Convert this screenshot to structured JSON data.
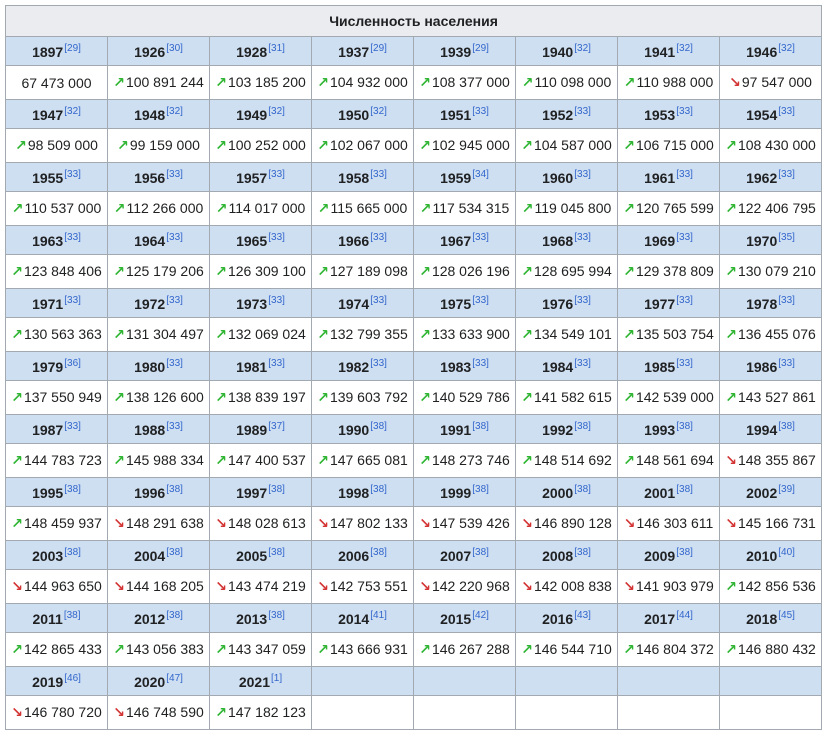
{
  "title": "Численность населения",
  "colors": {
    "up": "#2fb532",
    "down": "#d33333",
    "header_bg": "#cedff2",
    "title_bg": "#eaecf0"
  },
  "icons": {
    "up": "up-trend-arrow-icon",
    "down": "down-trend-arrow-icon"
  },
  "rows": [
    [
      {
        "year": "1897",
        "ref": "[29]",
        "value": "67 473 000",
        "trend": ""
      },
      {
        "year": "1926",
        "ref": "[30]",
        "value": "100 891 244",
        "trend": "up"
      },
      {
        "year": "1928",
        "ref": "[31]",
        "value": "103 185 200",
        "trend": "up"
      },
      {
        "year": "1937",
        "ref": "[29]",
        "value": "104 932 000",
        "trend": "up"
      },
      {
        "year": "1939",
        "ref": "[29]",
        "value": "108 377 000",
        "trend": "up"
      },
      {
        "year": "1940",
        "ref": "[32]",
        "value": "110 098 000",
        "trend": "up"
      },
      {
        "year": "1941",
        "ref": "[32]",
        "value": "110 988 000",
        "trend": "up"
      },
      {
        "year": "1946",
        "ref": "[32]",
        "value": "97 547 000",
        "trend": "down"
      }
    ],
    [
      {
        "year": "1947",
        "ref": "[32]",
        "value": "98 509 000",
        "trend": "up"
      },
      {
        "year": "1948",
        "ref": "[32]",
        "value": "99 159 000",
        "trend": "up"
      },
      {
        "year": "1949",
        "ref": "[32]",
        "value": "100 252 000",
        "trend": "up"
      },
      {
        "year": "1950",
        "ref": "[32]",
        "value": "102 067 000",
        "trend": "up"
      },
      {
        "year": "1951",
        "ref": "[33]",
        "value": "102 945 000",
        "trend": "up"
      },
      {
        "year": "1952",
        "ref": "[33]",
        "value": "104 587 000",
        "trend": "up"
      },
      {
        "year": "1953",
        "ref": "[33]",
        "value": "106 715 000",
        "trend": "up"
      },
      {
        "year": "1954",
        "ref": "[33]",
        "value": "108 430 000",
        "trend": "up"
      }
    ],
    [
      {
        "year": "1955",
        "ref": "[33]",
        "value": "110 537 000",
        "trend": "up"
      },
      {
        "year": "1956",
        "ref": "[33]",
        "value": "112 266 000",
        "trend": "up"
      },
      {
        "year": "1957",
        "ref": "[33]",
        "value": "114 017 000",
        "trend": "up"
      },
      {
        "year": "1958",
        "ref": "[33]",
        "value": "115 665 000",
        "trend": "up"
      },
      {
        "year": "1959",
        "ref": "[34]",
        "value": "117 534 315",
        "trend": "up"
      },
      {
        "year": "1960",
        "ref": "[33]",
        "value": "119 045 800",
        "trend": "up"
      },
      {
        "year": "1961",
        "ref": "[33]",
        "value": "120 765 599",
        "trend": "up"
      },
      {
        "year": "1962",
        "ref": "[33]",
        "value": "122 406 795",
        "trend": "up"
      }
    ],
    [
      {
        "year": "1963",
        "ref": "[33]",
        "value": "123 848 406",
        "trend": "up"
      },
      {
        "year": "1964",
        "ref": "[33]",
        "value": "125 179 206",
        "trend": "up"
      },
      {
        "year": "1965",
        "ref": "[33]",
        "value": "126 309 100",
        "trend": "up"
      },
      {
        "year": "1966",
        "ref": "[33]",
        "value": "127 189 098",
        "trend": "up"
      },
      {
        "year": "1967",
        "ref": "[33]",
        "value": "128 026 196",
        "trend": "up"
      },
      {
        "year": "1968",
        "ref": "[33]",
        "value": "128 695 994",
        "trend": "up"
      },
      {
        "year": "1969",
        "ref": "[33]",
        "value": "129 378 809",
        "trend": "up"
      },
      {
        "year": "1970",
        "ref": "[35]",
        "value": "130 079 210",
        "trend": "up"
      }
    ],
    [
      {
        "year": "1971",
        "ref": "[33]",
        "value": "130 563 363",
        "trend": "up"
      },
      {
        "year": "1972",
        "ref": "[33]",
        "value": "131 304 497",
        "trend": "up"
      },
      {
        "year": "1973",
        "ref": "[33]",
        "value": "132 069 024",
        "trend": "up"
      },
      {
        "year": "1974",
        "ref": "[33]",
        "value": "132 799 355",
        "trend": "up"
      },
      {
        "year": "1975",
        "ref": "[33]",
        "value": "133 633 900",
        "trend": "up"
      },
      {
        "year": "1976",
        "ref": "[33]",
        "value": "134 549 101",
        "trend": "up"
      },
      {
        "year": "1977",
        "ref": "[33]",
        "value": "135 503 754",
        "trend": "up"
      },
      {
        "year": "1978",
        "ref": "[33]",
        "value": "136 455 076",
        "trend": "up"
      }
    ],
    [
      {
        "year": "1979",
        "ref": "[36]",
        "value": "137 550 949",
        "trend": "up"
      },
      {
        "year": "1980",
        "ref": "[33]",
        "value": "138 126 600",
        "trend": "up"
      },
      {
        "year": "1981",
        "ref": "[33]",
        "value": "138 839 197",
        "trend": "up"
      },
      {
        "year": "1982",
        "ref": "[33]",
        "value": "139 603 792",
        "trend": "up"
      },
      {
        "year": "1983",
        "ref": "[33]",
        "value": "140 529 786",
        "trend": "up"
      },
      {
        "year": "1984",
        "ref": "[33]",
        "value": "141 582 615",
        "trend": "up"
      },
      {
        "year": "1985",
        "ref": "[33]",
        "value": "142 539 000",
        "trend": "up"
      },
      {
        "year": "1986",
        "ref": "[33]",
        "value": "143 527 861",
        "trend": "up"
      }
    ],
    [
      {
        "year": "1987",
        "ref": "[33]",
        "value": "144 783 723",
        "trend": "up"
      },
      {
        "year": "1988",
        "ref": "[33]",
        "value": "145 988 334",
        "trend": "up"
      },
      {
        "year": "1989",
        "ref": "[37]",
        "value": "147 400 537",
        "trend": "up"
      },
      {
        "year": "1990",
        "ref": "[38]",
        "value": "147 665 081",
        "trend": "up"
      },
      {
        "year": "1991",
        "ref": "[38]",
        "value": "148 273 746",
        "trend": "up"
      },
      {
        "year": "1992",
        "ref": "[38]",
        "value": "148 514 692",
        "trend": "up"
      },
      {
        "year": "1993",
        "ref": "[38]",
        "value": "148 561 694",
        "trend": "up"
      },
      {
        "year": "1994",
        "ref": "[38]",
        "value": "148 355 867",
        "trend": "down"
      }
    ],
    [
      {
        "year": "1995",
        "ref": "[38]",
        "value": "148 459 937",
        "trend": "up"
      },
      {
        "year": "1996",
        "ref": "[38]",
        "value": "148 291 638",
        "trend": "down"
      },
      {
        "year": "1997",
        "ref": "[38]",
        "value": "148 028 613",
        "trend": "down"
      },
      {
        "year": "1998",
        "ref": "[38]",
        "value": "147 802 133",
        "trend": "down"
      },
      {
        "year": "1999",
        "ref": "[38]",
        "value": "147 539 426",
        "trend": "down"
      },
      {
        "year": "2000",
        "ref": "[38]",
        "value": "146 890 128",
        "trend": "down"
      },
      {
        "year": "2001",
        "ref": "[38]",
        "value": "146 303 611",
        "trend": "down"
      },
      {
        "year": "2002",
        "ref": "[39]",
        "value": "145 166 731",
        "trend": "down"
      }
    ],
    [
      {
        "year": "2003",
        "ref": "[38]",
        "value": "144 963 650",
        "trend": "down"
      },
      {
        "year": "2004",
        "ref": "[38]",
        "value": "144 168 205",
        "trend": "down"
      },
      {
        "year": "2005",
        "ref": "[38]",
        "value": "143 474 219",
        "trend": "down"
      },
      {
        "year": "2006",
        "ref": "[38]",
        "value": "142 753 551",
        "trend": "down"
      },
      {
        "year": "2007",
        "ref": "[38]",
        "value": "142 220 968",
        "trend": "down"
      },
      {
        "year": "2008",
        "ref": "[38]",
        "value": "142 008 838",
        "trend": "down"
      },
      {
        "year": "2009",
        "ref": "[38]",
        "value": "141 903 979",
        "trend": "down"
      },
      {
        "year": "2010",
        "ref": "[40]",
        "value": "142 856 536",
        "trend": "up"
      }
    ],
    [
      {
        "year": "2011",
        "ref": "[38]",
        "value": "142 865 433",
        "trend": "up"
      },
      {
        "year": "2012",
        "ref": "[38]",
        "value": "143 056 383",
        "trend": "up"
      },
      {
        "year": "2013",
        "ref": "[38]",
        "value": "143 347 059",
        "trend": "up"
      },
      {
        "year": "2014",
        "ref": "[41]",
        "value": "143 666 931",
        "trend": "up"
      },
      {
        "year": "2015",
        "ref": "[42]",
        "value": "146 267 288",
        "trend": "up"
      },
      {
        "year": "2016",
        "ref": "[43]",
        "value": "146 544 710",
        "trend": "up"
      },
      {
        "year": "2017",
        "ref": "[44]",
        "value": "146 804 372",
        "trend": "up"
      },
      {
        "year": "2018",
        "ref": "[45]",
        "value": "146 880 432",
        "trend": "up"
      }
    ],
    [
      {
        "year": "2019",
        "ref": "[46]",
        "value": "146 780 720",
        "trend": "down"
      },
      {
        "year": "2020",
        "ref": "[47]",
        "value": "146 748 590",
        "trend": "down"
      },
      {
        "year": "2021",
        "ref": "[1]",
        "value": "147 182 123",
        "trend": "up"
      }
    ]
  ]
}
